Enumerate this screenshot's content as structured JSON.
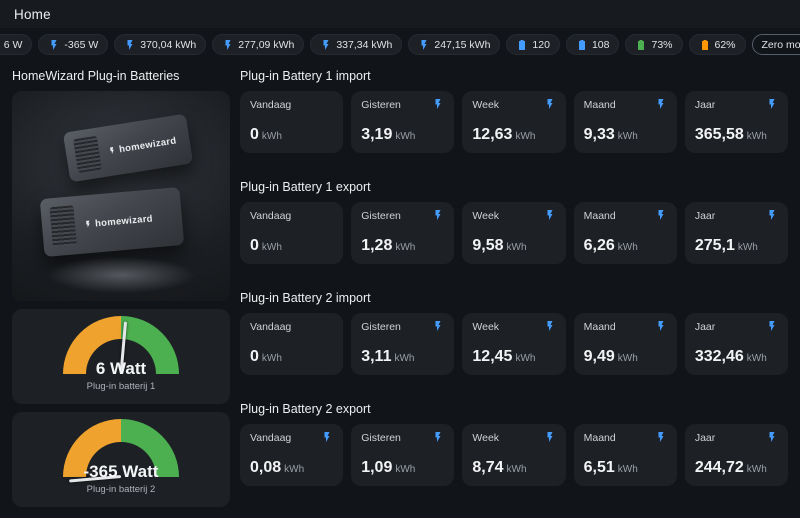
{
  "header": {
    "title": "Home"
  },
  "chips": [
    {
      "label": "6 W"
    },
    {
      "label": "-365 W"
    },
    {
      "label": "370,04 kWh"
    },
    {
      "label": "277,09 kWh"
    },
    {
      "label": "337,34 kWh"
    },
    {
      "label": "247,15 kWh"
    },
    {
      "label": "120"
    },
    {
      "label": "108"
    },
    {
      "label": "73%"
    },
    {
      "label": "62%"
    },
    {
      "label": "Zero mode"
    }
  ],
  "colors": {
    "accent_blue": "#459cff",
    "battery_green": "#4caf50",
    "battery_orange": "#ff9800",
    "gauge_orange": "#efa22d",
    "gauge_green": "#4caf50",
    "card_background": "#1d2024",
    "page_background": "#111418"
  },
  "left": {
    "heading": "HomeWizard Plug-in Batteries",
    "image": {
      "brand_label": "homewizard"
    },
    "gauges": [
      {
        "value": "6 Watt",
        "name": "Plug-in batterij 1",
        "needle_deg": -85
      },
      {
        "value": "-365 Watt",
        "name": "Plug-in batterij 2",
        "needle_deg": -185
      }
    ]
  },
  "sections": [
    {
      "title": "Plug-in Battery 1 import",
      "cards": [
        {
          "label": "Vandaag",
          "value": "0",
          "unit": "kWh"
        },
        {
          "label": "Gisteren",
          "value": "3,19",
          "unit": "kWh"
        },
        {
          "label": "Week",
          "value": "12,63",
          "unit": "kWh"
        },
        {
          "label": "Maand",
          "value": "9,33",
          "unit": "kWh"
        },
        {
          "label": "Jaar",
          "value": "365,58",
          "unit": "kWh"
        }
      ]
    },
    {
      "title": "Plug-in Battery 1 export",
      "cards": [
        {
          "label": "Vandaag",
          "value": "0",
          "unit": "kWh"
        },
        {
          "label": "Gisteren",
          "value": "1,28",
          "unit": "kWh"
        },
        {
          "label": "Week",
          "value": "9,58",
          "unit": "kWh"
        },
        {
          "label": "Maand",
          "value": "6,26",
          "unit": "kWh"
        },
        {
          "label": "Jaar",
          "value": "275,1",
          "unit": "kWh"
        }
      ]
    },
    {
      "title": "Plug-in Battery 2 import",
      "cards": [
        {
          "label": "Vandaag",
          "value": "0",
          "unit": "kWh"
        },
        {
          "label": "Gisteren",
          "value": "3,11",
          "unit": "kWh"
        },
        {
          "label": "Week",
          "value": "12,45",
          "unit": "kWh"
        },
        {
          "label": "Maand",
          "value": "9,49",
          "unit": "kWh"
        },
        {
          "label": "Jaar",
          "value": "332,46",
          "unit": "kWh"
        }
      ]
    },
    {
      "title": "Plug-in Battery 2 export",
      "cards": [
        {
          "label": "Vandaag",
          "value": "0,08",
          "unit": "kWh"
        },
        {
          "label": "Gisteren",
          "value": "1,09",
          "unit": "kWh"
        },
        {
          "label": "Week",
          "value": "8,74",
          "unit": "kWh"
        },
        {
          "label": "Maand",
          "value": "6,51",
          "unit": "kWh"
        },
        {
          "label": "Jaar",
          "value": "244,72",
          "unit": "kWh"
        }
      ]
    }
  ]
}
